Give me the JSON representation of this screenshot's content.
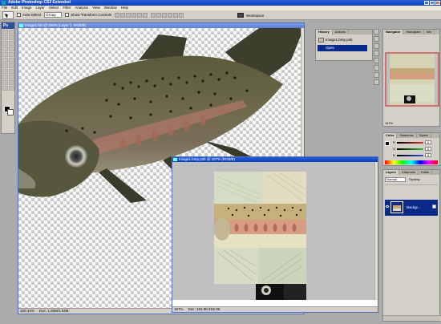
{
  "window": {
    "title": "Adobe Photoshop CS3 Extended",
    "btn_min": "_",
    "btn_max": "□",
    "btn_close": "×"
  },
  "menu": [
    "File",
    "Edit",
    "Image",
    "Layer",
    "Select",
    "Filter",
    "Analysis",
    "View",
    "Window",
    "Help"
  ],
  "options": {
    "auto_select_label": "Auto-Select",
    "auto_select_value": "Group",
    "show_transform_label": "Show Transform Controls",
    "workspace_label": "Workspace"
  },
  "toolbox": {
    "logo": "Ps"
  },
  "doc1": {
    "title": "Image1.tile @ 100% (Layer 1, RGB/8)",
    "zoom": "100.44%",
    "doc_info": "Doc: 1.00M/1.04M"
  },
  "doc2": {
    "title": "Image1.bmp.psb @ 167% (RGB/8)",
    "zoom": "167%",
    "doc_info": "Doc: 192.0K/192.0K"
  },
  "history_panel": {
    "tabs": [
      "History",
      "Actions"
    ],
    "items": [
      {
        "label": "Image1.bmp.psb",
        "selected": false
      },
      {
        "label": "Open",
        "selected": true
      }
    ]
  },
  "navigator_panel": {
    "tabs": [
      "Navigator",
      "Histogram",
      "Info"
    ],
    "zoom": "167%"
  },
  "color_panel": {
    "tabs": [
      "Color",
      "Swatches",
      "Styles"
    ],
    "channels": [
      {
        "label": "R",
        "value": "0",
        "color": "#e03030"
      },
      {
        "label": "G",
        "value": "0",
        "color": "#30c030"
      },
      {
        "label": "B",
        "value": "0",
        "color": "#3050e0"
      }
    ]
  },
  "layers_panel": {
    "tabs": [
      "Layers",
      "Channels",
      "Paths"
    ],
    "blend_mode": "Normal",
    "opacity_label": "Opacity:",
    "layer_name": "Backgr..."
  },
  "colors": {
    "titlebar": "#0b3fb8",
    "selection": "#0a2a8a"
  }
}
